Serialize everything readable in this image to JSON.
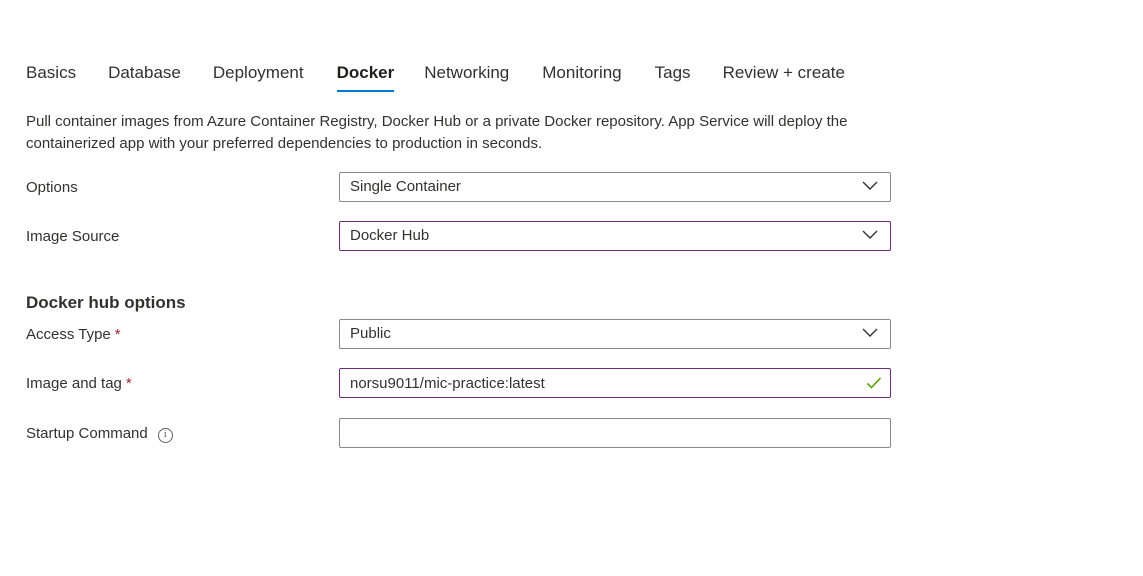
{
  "tabs": [
    {
      "label": "Basics",
      "active": false
    },
    {
      "label": "Database",
      "active": false
    },
    {
      "label": "Deployment",
      "active": false
    },
    {
      "label": "Docker",
      "active": true
    },
    {
      "label": "Networking",
      "active": false
    },
    {
      "label": "Monitoring",
      "active": false
    },
    {
      "label": "Tags",
      "active": false
    },
    {
      "label": "Review + create",
      "active": false
    }
  ],
  "description": "Pull container images from Azure Container Registry, Docker Hub or a private Docker repository. App Service will deploy the containerized app with your preferred dependencies to production in seconds.",
  "options": {
    "label": "Options",
    "value": "Single Container"
  },
  "image_source": {
    "label": "Image Source",
    "value": "Docker Hub"
  },
  "docker_hub_section": {
    "heading": "Docker hub options"
  },
  "access_type": {
    "label": "Access Type",
    "required_mark": "*",
    "value": "Public"
  },
  "image_and_tag": {
    "label": "Image and tag",
    "required_mark": "*",
    "value": "norsu9011/mic-practice:latest",
    "valid": true
  },
  "startup_command": {
    "label": "Startup Command",
    "value": "",
    "info_icon": "info-icon"
  },
  "colors": {
    "accent": "#0078d4",
    "focus_border": "#6b2a7a",
    "required": "#a4262c",
    "valid_check": "#57a300"
  }
}
